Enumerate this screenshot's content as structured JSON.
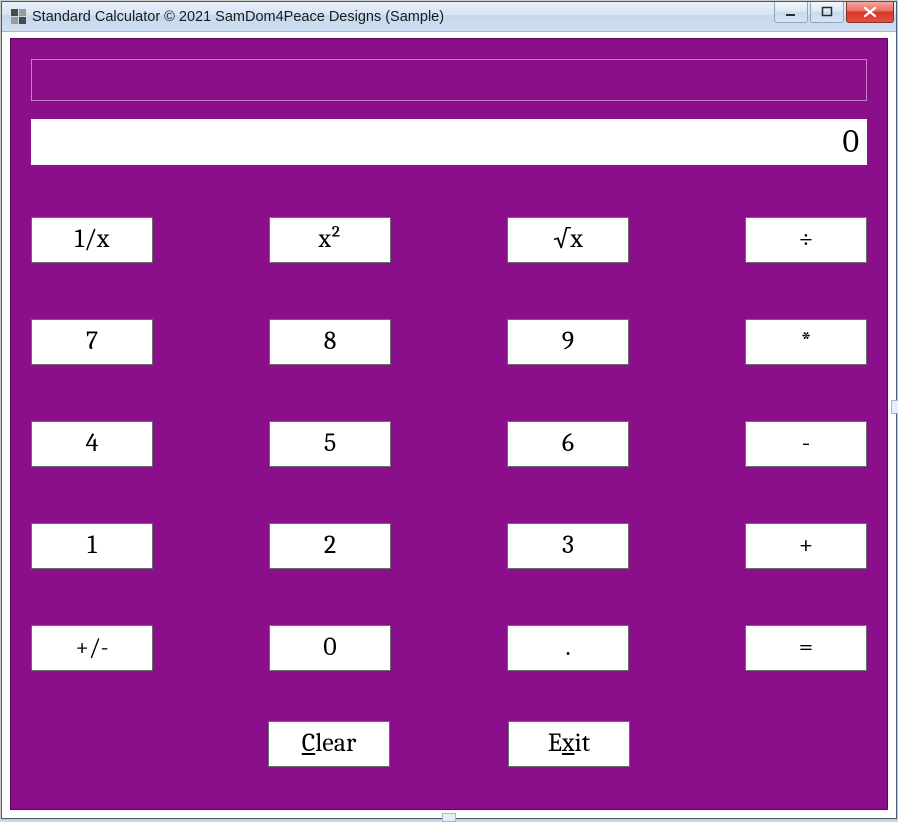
{
  "window": {
    "title": "Standard Calculator © 2021 SamDom4Peace Designs (Sample)"
  },
  "display": {
    "history": "",
    "value": "0"
  },
  "buttons": {
    "reciprocal": "1/x",
    "square": "x²",
    "sqrt": "√x",
    "divide": "÷",
    "seven": "7",
    "eight": "8",
    "nine": "9",
    "multiply": "*",
    "four": "4",
    "five": "5",
    "six": "6",
    "subtract": "-",
    "one": "1",
    "two": "2",
    "three": "3",
    "add": "+",
    "sign": "+/-",
    "zero": "0",
    "decimal": ".",
    "equals": "=",
    "clear_pre": "",
    "clear_mn": "C",
    "clear_post": "lear",
    "exit_pre": "E",
    "exit_mn": "x",
    "exit_post": "it"
  },
  "colors": {
    "client_bg": "#8b0e8b",
    "button_bg": "#ffffff"
  }
}
